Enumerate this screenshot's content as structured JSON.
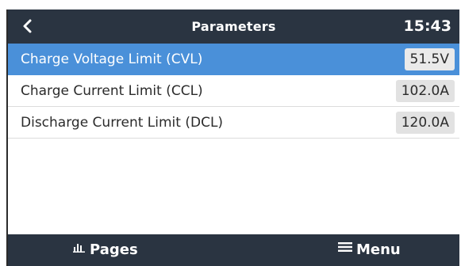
{
  "header": {
    "title": "Parameters",
    "time": "15:43",
    "back_icon": "chevron-left-icon"
  },
  "rows": [
    {
      "label": "Charge Voltage Limit (CVL)",
      "value": "51.5V",
      "selected": true
    },
    {
      "label": "Charge Current Limit (CCL)",
      "value": "102.0A",
      "selected": false
    },
    {
      "label": "Discharge Current Limit (DCL)",
      "value": "120.0A",
      "selected": false
    }
  ],
  "footer": {
    "pages_label": "Pages",
    "pages_icon": "bar-chart-icon",
    "menu_label": "Menu",
    "menu_icon": "hamburger-menu-icon"
  },
  "colors": {
    "header_bg": "#2a3441",
    "selected_row": "#4a90d9",
    "value_box": "#e2e2e2"
  }
}
